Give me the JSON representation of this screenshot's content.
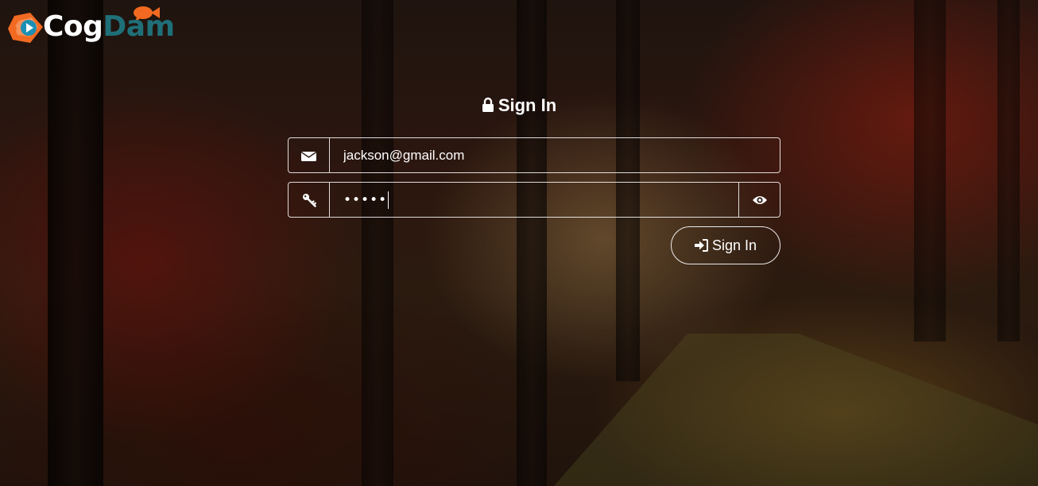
{
  "logo": {
    "part_light": "Cog",
    "part_dark": "Dam",
    "colors": {
      "mark_orange": "#f26a21",
      "mark_blue": "#1c8fb5",
      "text_light": "#ffffff",
      "text_dark": "#1f6f78"
    }
  },
  "form": {
    "title": "Sign In",
    "title_icon": "lock-icon",
    "email": {
      "icon": "envelope-icon",
      "value": "jackson@gmail.com"
    },
    "password": {
      "icon": "key-icon",
      "masked_value": "•••••",
      "toggle_icon": "eye-icon"
    },
    "submit": {
      "icon": "sign-in-icon",
      "label": "Sign In"
    }
  },
  "background": {
    "description_colors": [
      "#3b1e14",
      "#c8281a",
      "#a87830"
    ]
  }
}
